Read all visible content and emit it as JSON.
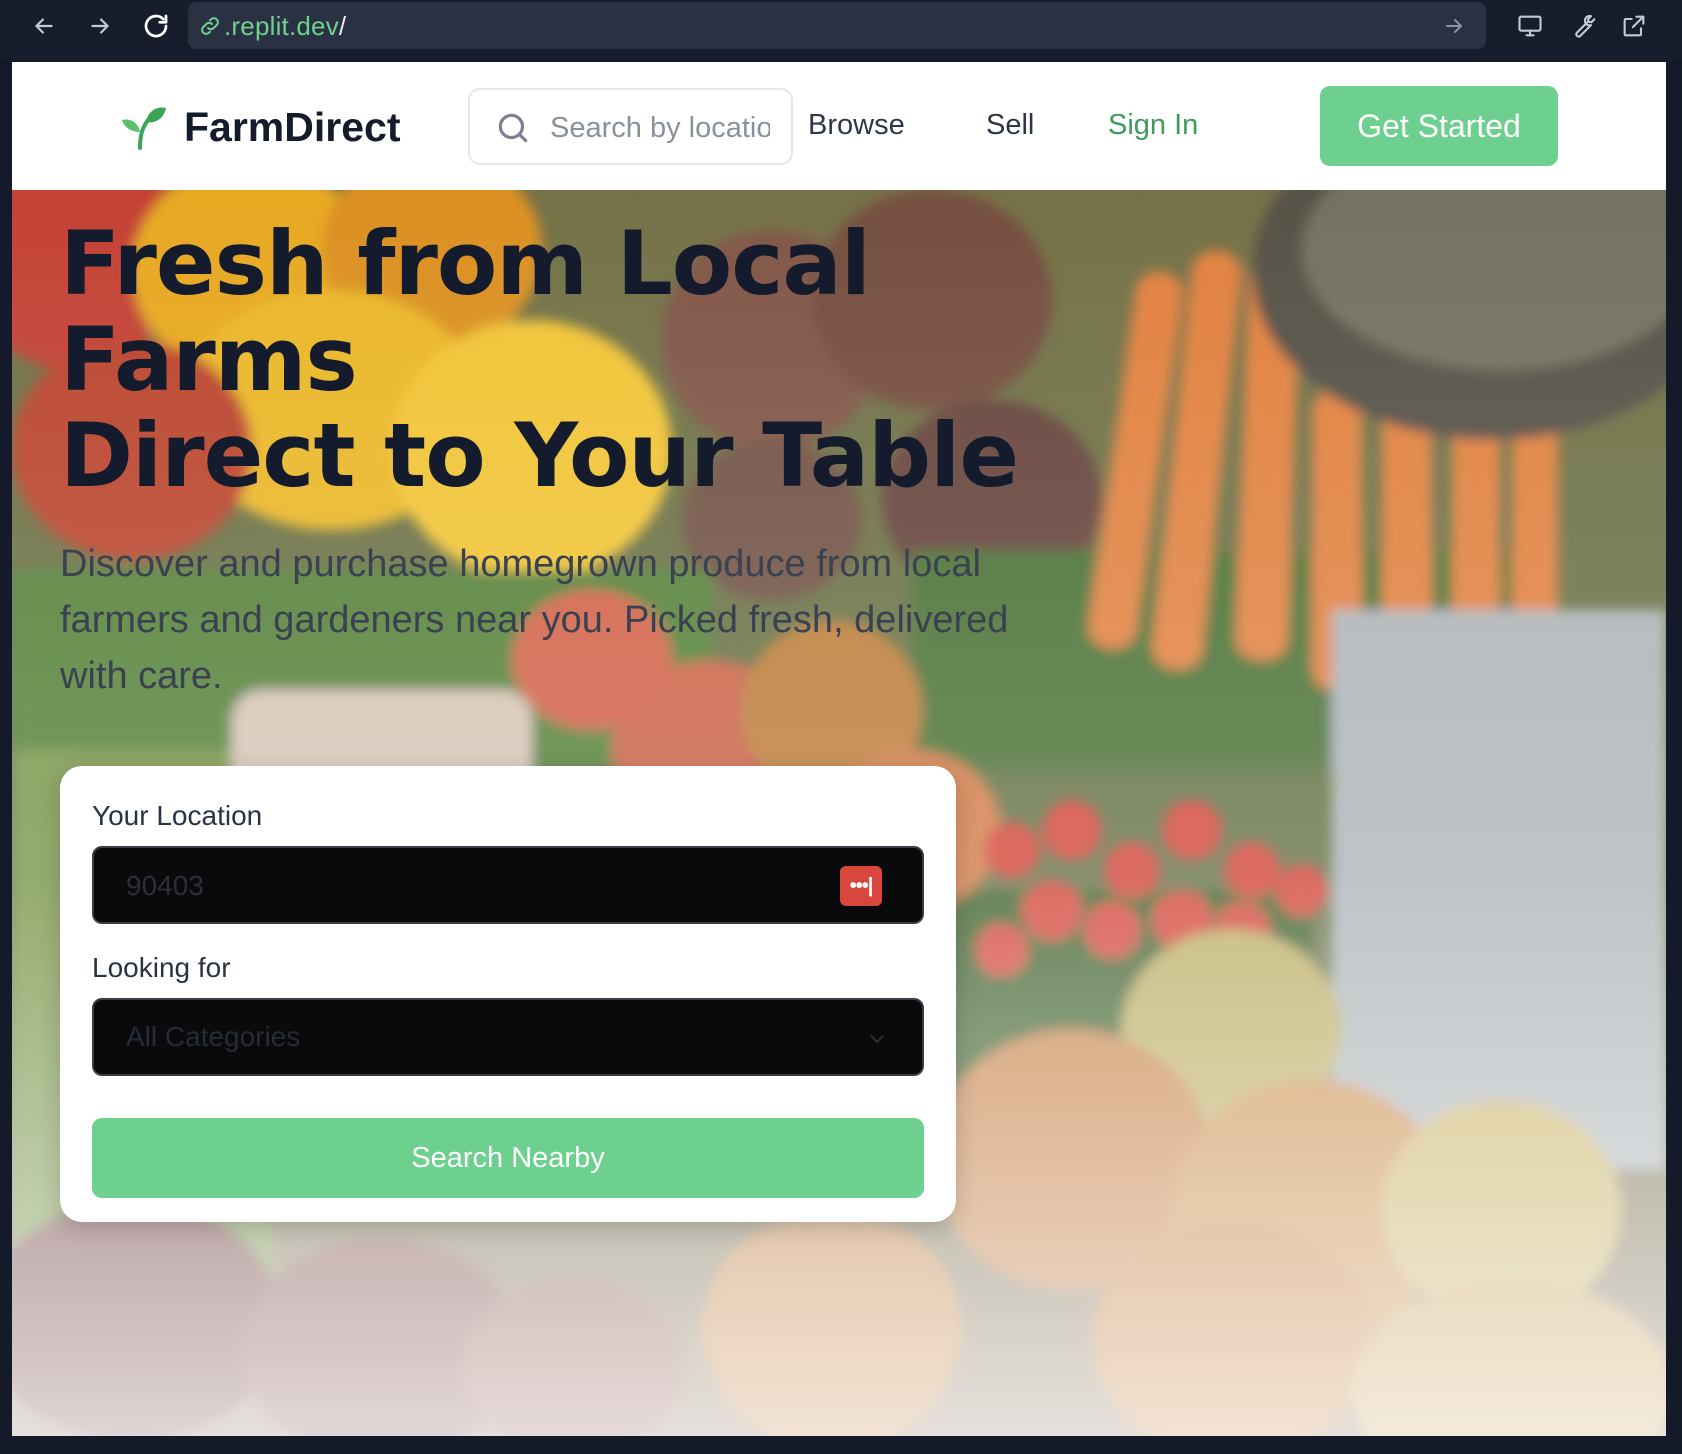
{
  "browser": {
    "url_domain": ".replit.dev",
    "url_path": "/"
  },
  "brand": {
    "name": "FarmDirect",
    "accent": "#6dd08f",
    "accent_text": "#3e9a5d"
  },
  "nav": {
    "search_placeholder": "Search by location",
    "browse": "Browse",
    "sell": "Sell",
    "sign_in": "Sign In",
    "get_started": "Get Started"
  },
  "hero": {
    "title_line1": "Fresh from Local",
    "title_line2": "Farms",
    "title_line3": "Direct to Your Table",
    "subtitle": "Discover and purchase homegrown produce from local farmers and gardeners near you. Picked fresh, delivered with care."
  },
  "search_card": {
    "location_label": "Your Location",
    "location_placeholder": "90403",
    "category_label": "Looking for",
    "category_selected": "All Categories",
    "submit": "Search Nearby"
  },
  "icons": {
    "back": "arrow-left-icon",
    "forward": "arrow-right-icon",
    "reload": "reload-icon",
    "link": "link-icon",
    "go": "arrow-right-icon",
    "devices": "monitor-icon",
    "tools": "wrench-icon",
    "external": "external-link-icon",
    "logo": "sprout-icon",
    "search": "search-icon",
    "password_manager": "password-dots-icon",
    "dropdown": "chevron-down-icon"
  }
}
